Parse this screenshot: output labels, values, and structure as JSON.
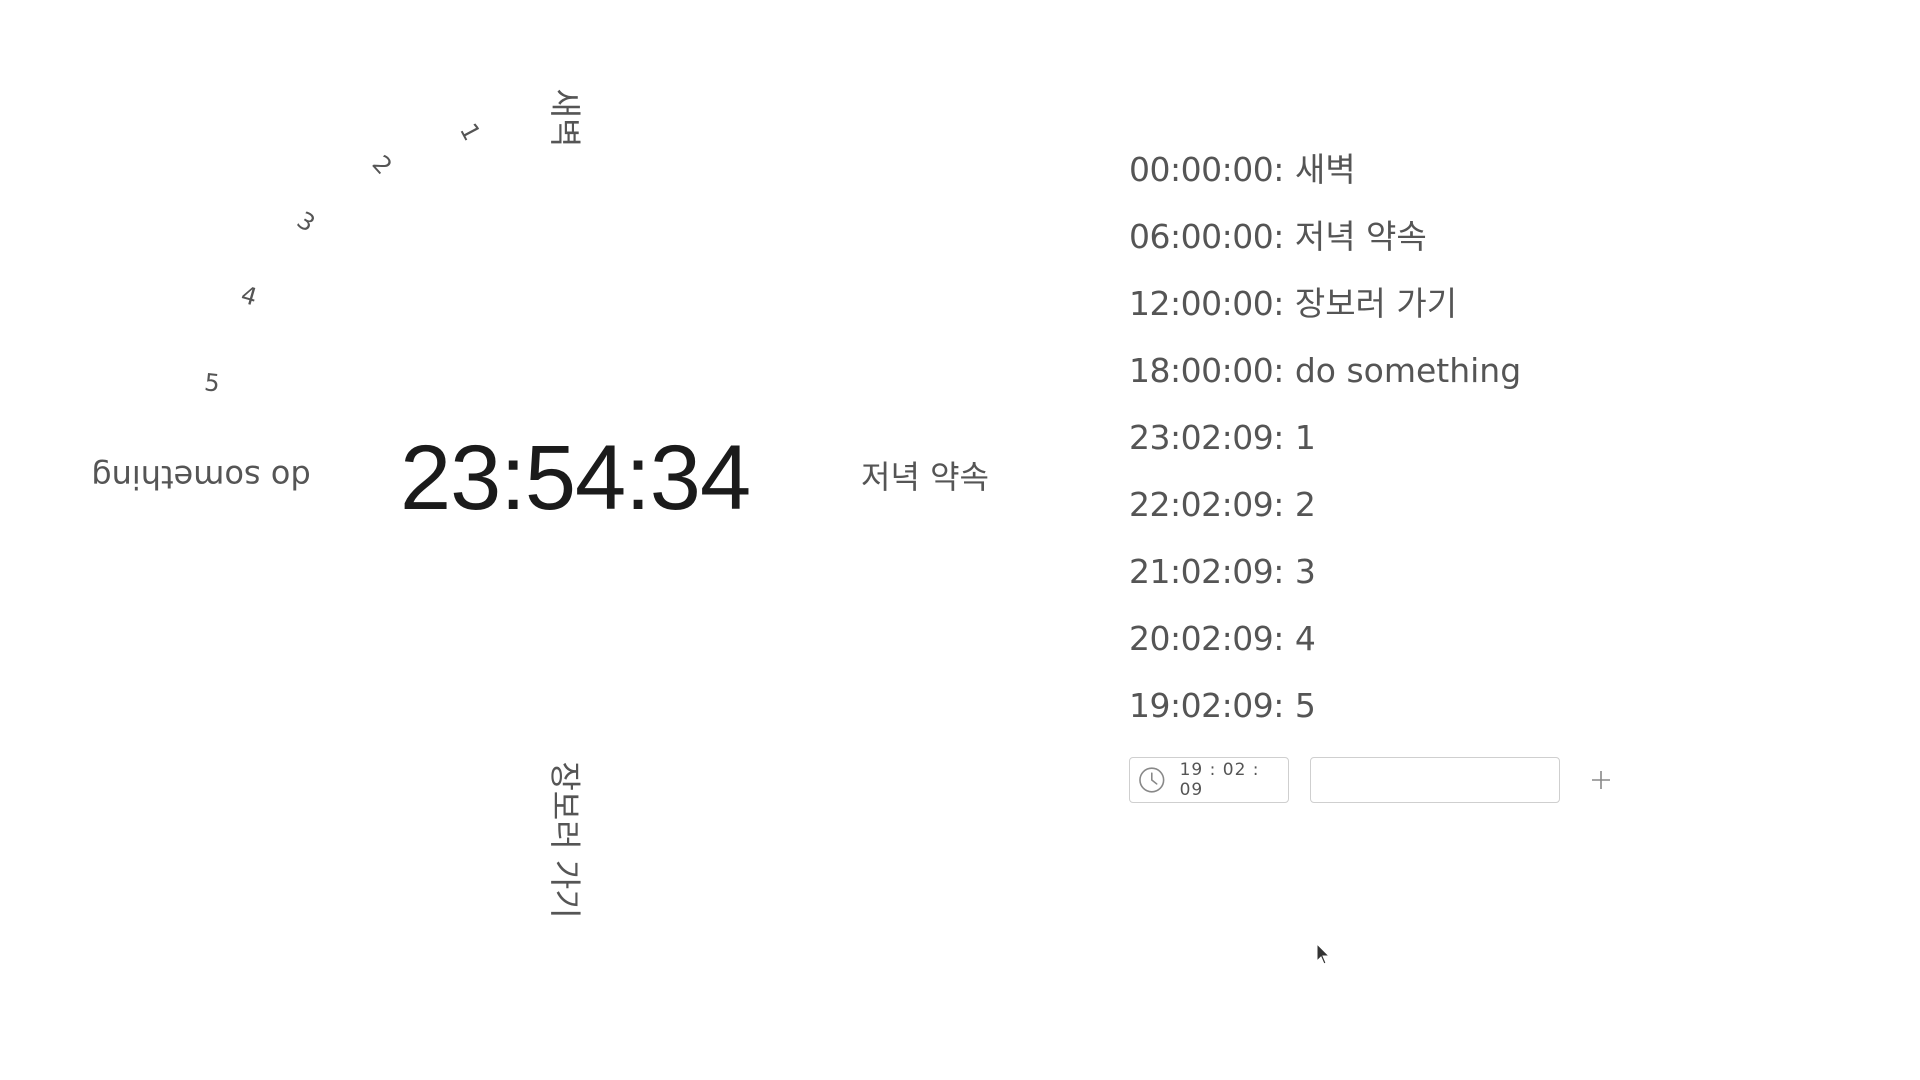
{
  "clock": {
    "time": "23:54:34"
  },
  "dial_labels": [
    {
      "name": "dial-label-dawn",
      "text": "새벽",
      "cls": ""
    },
    {
      "name": "dial-label-1",
      "text": "1",
      "cls": "small"
    },
    {
      "name": "dial-label-2",
      "text": "2",
      "cls": "small"
    },
    {
      "name": "dial-label-3",
      "text": "3",
      "cls": "small"
    },
    {
      "name": "dial-label-4",
      "text": "4",
      "cls": "small"
    },
    {
      "name": "dial-label-5",
      "text": "5",
      "cls": "small"
    },
    {
      "name": "dial-label-do-something",
      "text": "do something",
      "cls": ""
    },
    {
      "name": "dial-label-dinner",
      "text": "저녁 약속",
      "cls": ""
    },
    {
      "name": "dial-label-shopping",
      "text": "장보러 가기",
      "cls": ""
    }
  ],
  "schedule": {
    "items": [
      {
        "time": "00:00:00",
        "label": "새벽"
      },
      {
        "time": "06:00:00",
        "label": "저녁 약속"
      },
      {
        "time": "12:00:00",
        "label": "장보러 가기"
      },
      {
        "time": "18:00:00",
        "label": "do something"
      },
      {
        "time": "23:02:09",
        "label": "1"
      },
      {
        "time": "22:02:09",
        "label": "2"
      },
      {
        "time": "21:02:09",
        "label": "3"
      },
      {
        "time": "20:02:09",
        "label": "4"
      },
      {
        "time": "19:02:09",
        "label": "5"
      }
    ]
  },
  "add_form": {
    "time_value": "19 : 02 : 09",
    "text_value": "",
    "text_placeholder": "",
    "add_icon": "plus-icon",
    "time_icon": "clock-icon"
  }
}
